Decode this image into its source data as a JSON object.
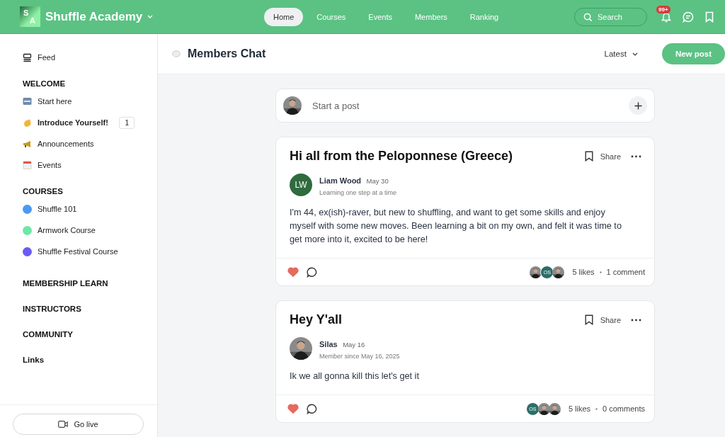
{
  "brand": {
    "logo_letters": [
      "S",
      "A"
    ],
    "name": "Shuffle Academy"
  },
  "nav": [
    {
      "label": "Home",
      "selected": true
    },
    {
      "label": "Courses",
      "selected": false
    },
    {
      "label": "Events",
      "selected": false
    },
    {
      "label": "Members",
      "selected": false
    },
    {
      "label": "Ranking",
      "selected": false
    }
  ],
  "search": {
    "placeholder": "Search"
  },
  "notifications": {
    "badge": "99+"
  },
  "sidebar": {
    "feed": "Feed",
    "sections": [
      {
        "title": "WELCOME",
        "items": [
          {
            "label": "Start here",
            "kind": "new-sign",
            "bold": false
          },
          {
            "label": "Introduce Yourself!",
            "kind": "wave",
            "bold": true,
            "badge": "1"
          },
          {
            "label": "Announcements",
            "kind": "megaphone",
            "bold": false
          },
          {
            "label": "Events",
            "kind": "calendar",
            "bold": false
          }
        ]
      },
      {
        "title": "COURSES",
        "items": [
          {
            "label": "Shuffle 101",
            "kind": "dot",
            "color": "#4a9af0",
            "bold": false
          },
          {
            "label": "Armwork Course",
            "kind": "dot",
            "color": "#6ee7a8",
            "bold": false
          },
          {
            "label": "Shuffle Festival Course",
            "kind": "dot",
            "color": "#6a5cf0",
            "bold": false
          }
        ]
      },
      {
        "title": "MEMBERSHIP LEARN"
      },
      {
        "title": "INSTRUCTORS"
      },
      {
        "title": "COMMUNITY"
      },
      {
        "title": "Links"
      }
    ],
    "go_live": "Go live"
  },
  "header": {
    "title": "Members Chat",
    "sort": "Latest",
    "new_post": "New post"
  },
  "composer": {
    "placeholder": "Start a post"
  },
  "posts": [
    {
      "title": "Hi all from the Peloponnese (Greece)",
      "share": "Share",
      "author": "Liam Wood",
      "date": "May 30",
      "subtitle": "Learning one step at a time",
      "avatar": {
        "kind": "initials",
        "text": "LW",
        "color": "#2f6b3f"
      },
      "body": "I'm 44, ex(ish)-raver, but new to shuffling, and want to get some skills and enjoy myself with some new moves. Been learning a bit on my own, and felt it was time to get more into it, excited to be here!",
      "liked": true,
      "likers": [
        {
          "kind": "picture"
        },
        {
          "kind": "initials",
          "text": "OS",
          "color": "#2b6e6a"
        },
        {
          "kind": "picture"
        }
      ],
      "likes": "5 likes",
      "comments": "1 comment"
    },
    {
      "title": "Hey Y'all",
      "share": "Share",
      "author": "Silas",
      "date": "May 16",
      "subtitle": "Member since May 16, 2025",
      "avatar": {
        "kind": "picture"
      },
      "body": "Ik we all gonna kill this let's get it",
      "liked": true,
      "likers": [
        {
          "kind": "initials",
          "text": "OS",
          "color": "#2b6e6a"
        },
        {
          "kind": "picture"
        },
        {
          "kind": "picture"
        }
      ],
      "likes": "5 likes",
      "comments": "0 comments"
    }
  ]
}
